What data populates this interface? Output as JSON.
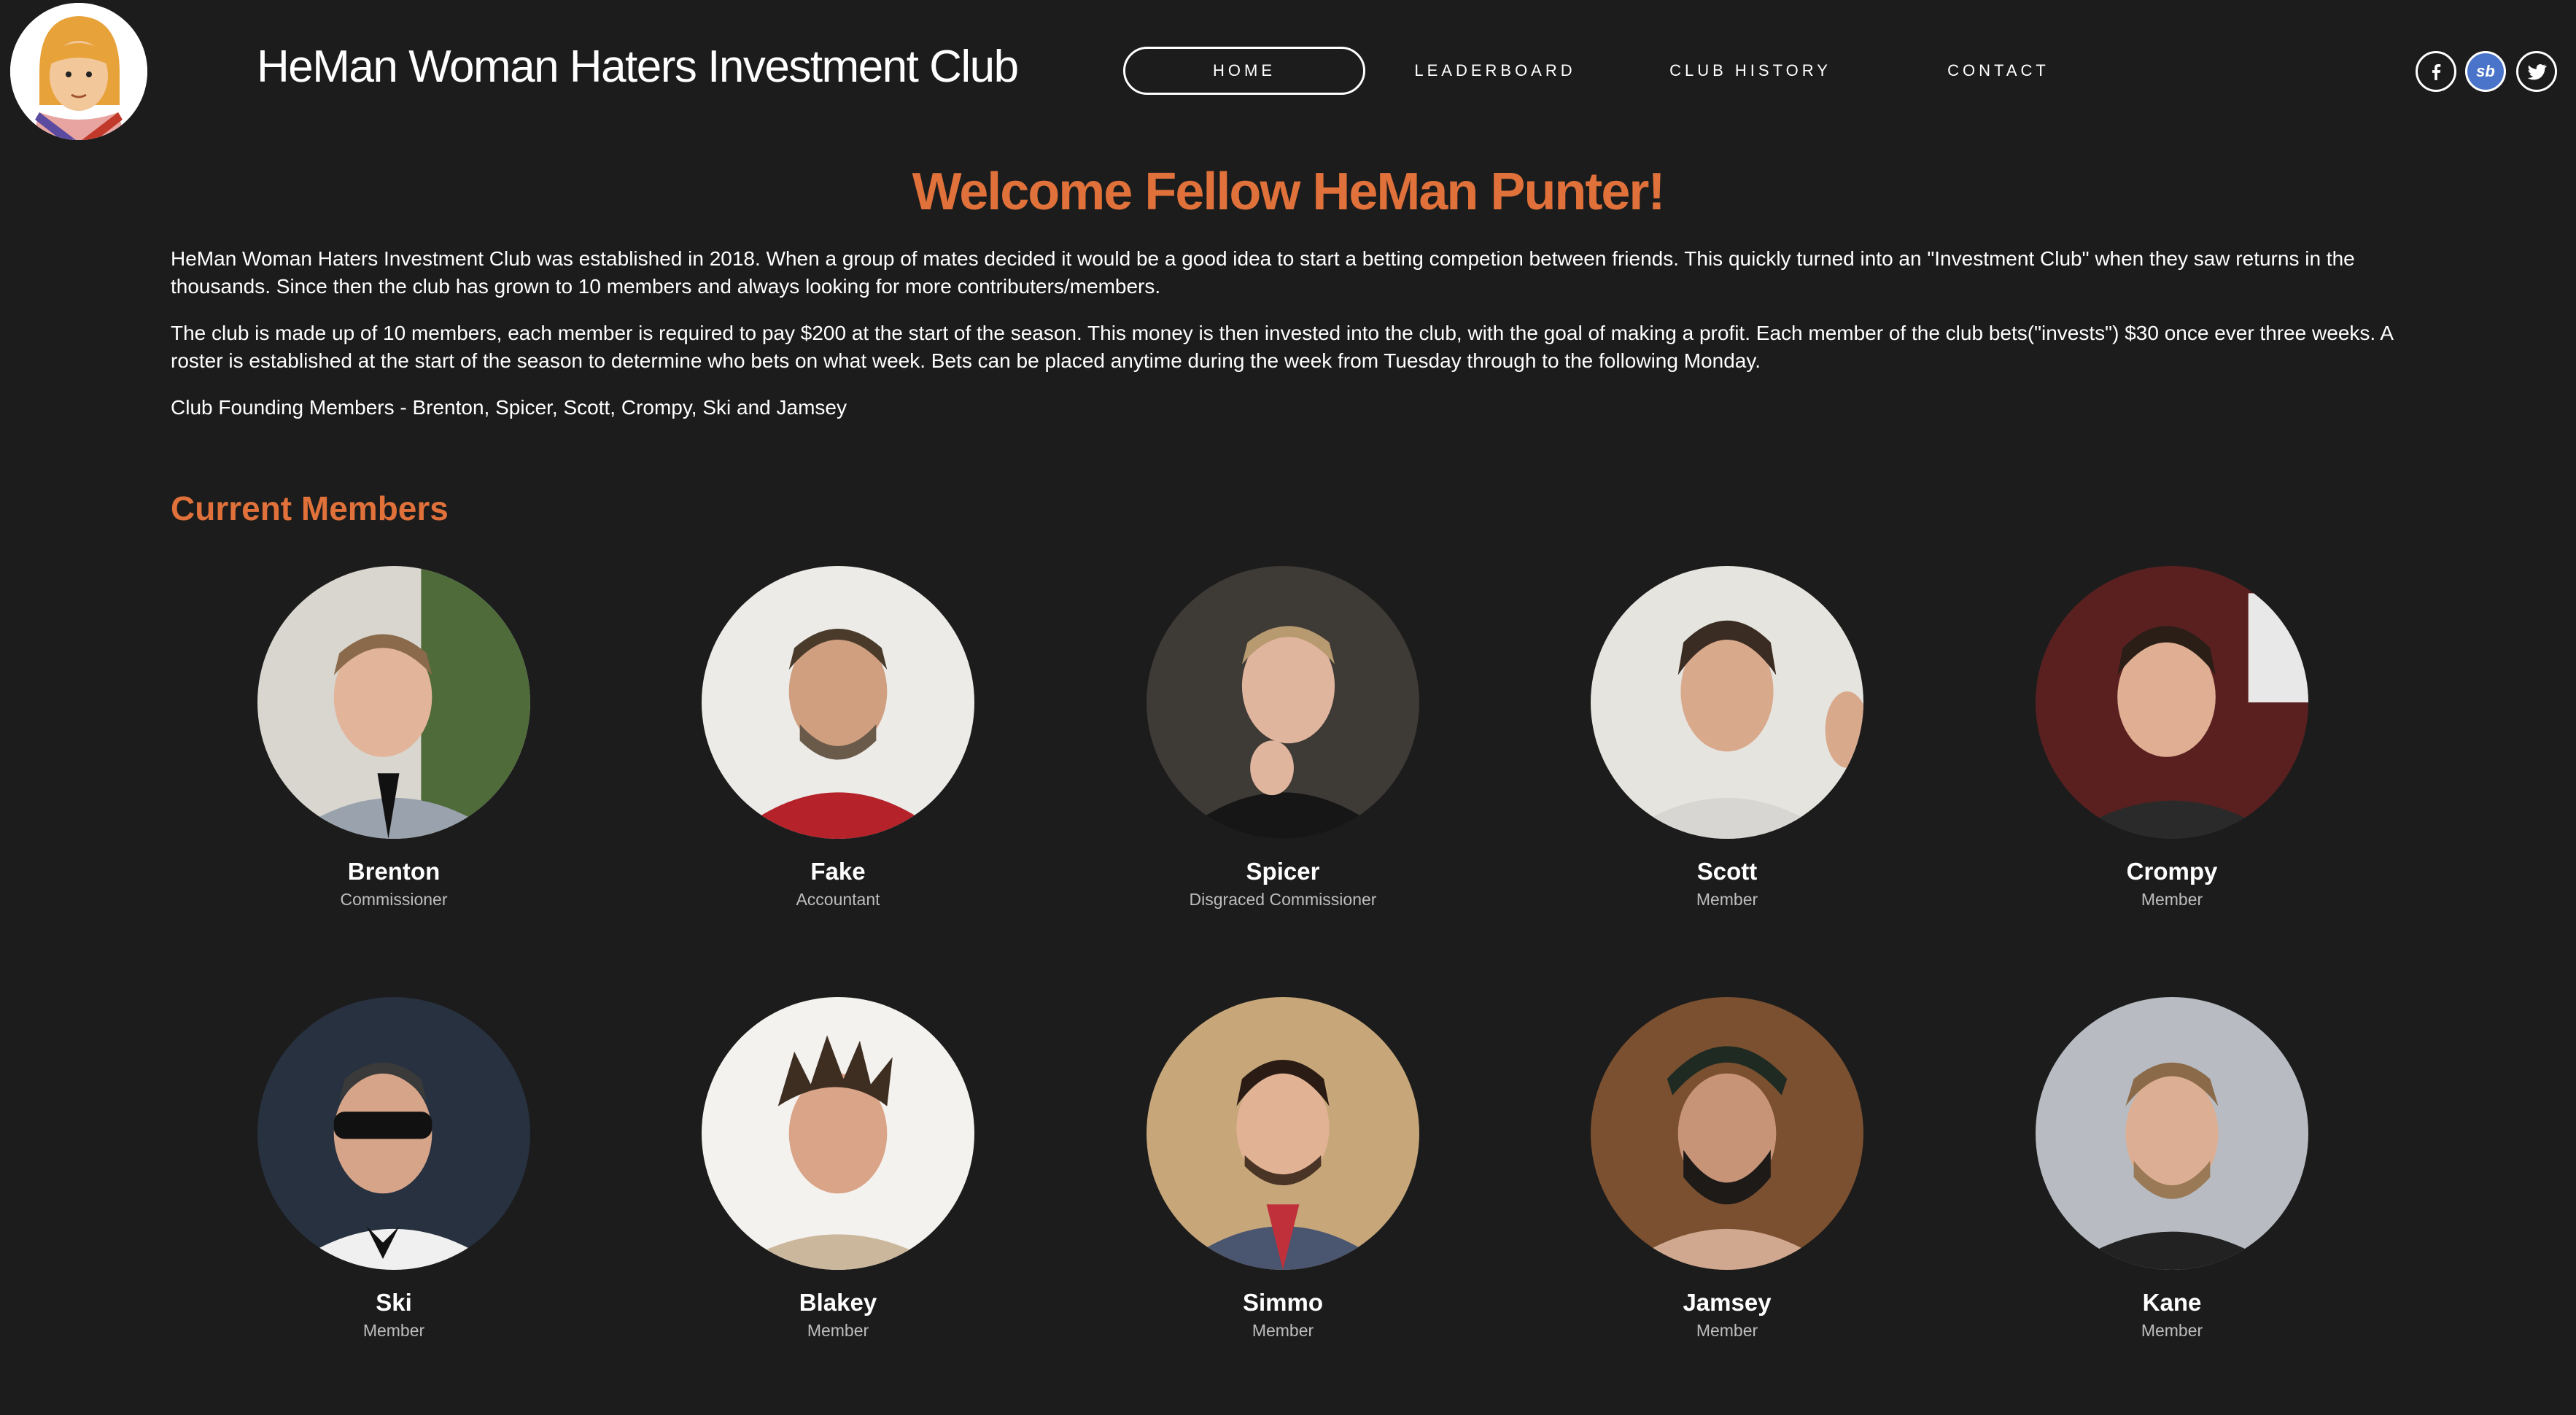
{
  "header": {
    "site_title": "HeMan Woman Haters Investment Club",
    "nav": [
      {
        "label": "HOME",
        "active": true
      },
      {
        "label": "LEADERBOARD",
        "active": false
      },
      {
        "label": "CLUB HISTORY",
        "active": false
      },
      {
        "label": "CONTACT",
        "active": false
      }
    ],
    "social": [
      {
        "name": "facebook-icon",
        "glyph": "f"
      },
      {
        "name": "sportsbet-icon",
        "glyph": "sb"
      },
      {
        "name": "twitter-icon",
        "glyph": "🐦"
      }
    ]
  },
  "main": {
    "welcome": "Welcome Fellow HeMan Punter!",
    "paragraphs": [
      "HeMan Woman Haters Investment Club was established in 2018. When a group of mates decided it would be a good idea to start a betting competion between friends. This quickly turned into an \"Investment Club\" when they saw returns in the thousands. Since then the club has grown to 10 members and always looking for more contributers/members.",
      "The club is made up of 10 members, each member is required to pay $200 at the start of the season. This money is then invested into the club, with the goal of making a profit. Each member of the club bets(\"invests\") $30 once ever three weeks. A roster is established at the start of the season to determine who bets on what week. Bets can be placed anytime during the week from Tuesday through to the following Monday.",
      "Club Founding Members - Brenton, Spicer, Scott, Crompy, Ski and Jamsey"
    ],
    "members_title": "Current Members",
    "members": [
      {
        "name": "Brenton",
        "role": "Commissioner"
      },
      {
        "name": "Fake",
        "role": "Accountant"
      },
      {
        "name": "Spicer",
        "role": "Disgraced Commissioner"
      },
      {
        "name": "Scott",
        "role": "Member"
      },
      {
        "name": "Crompy",
        "role": "Member"
      },
      {
        "name": "Ski",
        "role": "Member"
      },
      {
        "name": "Blakey",
        "role": "Member"
      },
      {
        "name": "Simmo",
        "role": "Member"
      },
      {
        "name": "Jamsey",
        "role": "Member"
      },
      {
        "name": "Kane",
        "role": "Member"
      }
    ]
  },
  "colors": {
    "background": "#1c1c1c",
    "accent": "#e0713a",
    "text": "#ffffff",
    "muted": "#bdbdbd"
  }
}
